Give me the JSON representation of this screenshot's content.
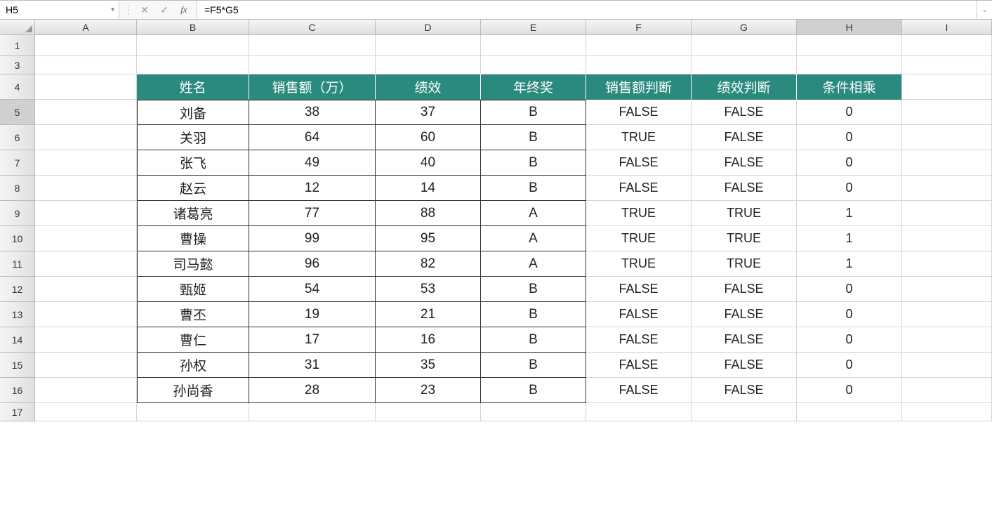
{
  "formulaBar": {
    "nameBox": "H5",
    "formula": "=F5*G5"
  },
  "columns": [
    "A",
    "B",
    "C",
    "D",
    "E",
    "F",
    "G",
    "H",
    "I"
  ],
  "visibleRows": [
    1,
    3,
    4,
    5,
    6,
    7,
    8,
    9,
    10,
    11,
    12,
    13,
    14,
    15,
    16,
    17
  ],
  "activeCell": {
    "col": "H",
    "row": 5
  },
  "tableHeaders": [
    "姓名",
    "销售额（万）",
    "绩效",
    "年终奖",
    "销售额判断",
    "绩效判断",
    "条件相乘"
  ],
  "tableData": [
    {
      "name": "刘备",
      "sales": "38",
      "perf": "37",
      "bonus": "B",
      "salesJudge": "FALSE",
      "perfJudge": "FALSE",
      "mult": "0"
    },
    {
      "name": "关羽",
      "sales": "64",
      "perf": "60",
      "bonus": "B",
      "salesJudge": "TRUE",
      "perfJudge": "FALSE",
      "mult": "0"
    },
    {
      "name": "张飞",
      "sales": "49",
      "perf": "40",
      "bonus": "B",
      "salesJudge": "FALSE",
      "perfJudge": "FALSE",
      "mult": "0"
    },
    {
      "name": "赵云",
      "sales": "12",
      "perf": "14",
      "bonus": "B",
      "salesJudge": "FALSE",
      "perfJudge": "FALSE",
      "mult": "0"
    },
    {
      "name": "诸葛亮",
      "sales": "77",
      "perf": "88",
      "bonus": "A",
      "salesJudge": "TRUE",
      "perfJudge": "TRUE",
      "mult": "1"
    },
    {
      "name": "曹操",
      "sales": "99",
      "perf": "95",
      "bonus": "A",
      "salesJudge": "TRUE",
      "perfJudge": "TRUE",
      "mult": "1"
    },
    {
      "name": "司马懿",
      "sales": "96",
      "perf": "82",
      "bonus": "A",
      "salesJudge": "TRUE",
      "perfJudge": "TRUE",
      "mult": "1"
    },
    {
      "name": "甄姬",
      "sales": "54",
      "perf": "53",
      "bonus": "B",
      "salesJudge": "FALSE",
      "perfJudge": "FALSE",
      "mult": "0"
    },
    {
      "name": "曹丕",
      "sales": "19",
      "perf": "21",
      "bonus": "B",
      "salesJudge": "FALSE",
      "perfJudge": "FALSE",
      "mult": "0"
    },
    {
      "name": "曹仁",
      "sales": "17",
      "perf": "16",
      "bonus": "B",
      "salesJudge": "FALSE",
      "perfJudge": "FALSE",
      "mult": "0"
    },
    {
      "name": "孙权",
      "sales": "31",
      "perf": "35",
      "bonus": "B",
      "salesJudge": "FALSE",
      "perfJudge": "FALSE",
      "mult": "0"
    },
    {
      "name": "孙尚香",
      "sales": "28",
      "perf": "23",
      "bonus": "B",
      "salesJudge": "FALSE",
      "perfJudge": "FALSE",
      "mult": "0"
    }
  ]
}
